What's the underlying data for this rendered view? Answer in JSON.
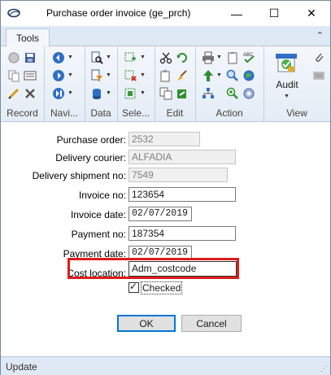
{
  "window": {
    "title": "Purchase order invoice (ge_prch)",
    "minimize": "—",
    "maximize": "☐",
    "close": "✕"
  },
  "ribbon": {
    "tab": "Tools",
    "collapse": "⌃",
    "groups": [
      "Record",
      "Navi...",
      "Data",
      "Sele...",
      "Edit",
      "Action",
      "View"
    ],
    "audit_label": "Audit"
  },
  "form": {
    "purchase_order_label": "Purchase order:",
    "purchase_order_value": "2532",
    "delivery_courier_label": "Delivery courier:",
    "delivery_courier_value": "ALFADIA",
    "delivery_shipment_label": "Delivery shipment no:",
    "delivery_shipment_value": "7549",
    "invoice_no_label": "Invoice no:",
    "invoice_no_value": "123654",
    "invoice_date_label": "Invoice date:",
    "invoice_date_value": "02/07/2019",
    "payment_no_label": "Payment no:",
    "payment_no_value": "187354",
    "payment_date_label": "Payment date:",
    "payment_date_value": "02/07/2019",
    "cost_location_label": "Cost location:",
    "cost_location_value": "Adm_costcode",
    "checked_label": "Checked",
    "checked": true,
    "checkmark": "✓"
  },
  "buttons": {
    "ok": "OK",
    "cancel": "Cancel"
  },
  "status": {
    "text": "Update",
    "grip": "⋰"
  },
  "colors": {
    "highlight": "#e01b1b",
    "ribbon_bg": "#dfe9f5",
    "default_button_border": "#0078d7"
  }
}
